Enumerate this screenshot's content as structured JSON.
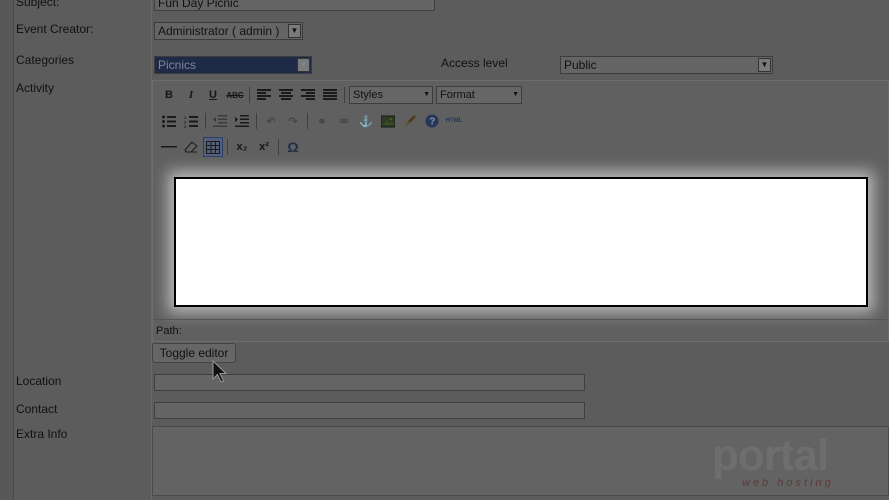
{
  "form": {
    "subject_label": "Subject:",
    "subject_value": "Fun Day Picnic",
    "event_creator_label": "Event Creator:",
    "event_creator_value": "Administrator ( admin )",
    "categories_label": "Categories",
    "categories_value": "Picnics",
    "access_level_label": "Access level",
    "access_level_value": "Public",
    "activity_label": "Activity",
    "location_label": "Location",
    "contact_label": "Contact",
    "extra_info_label": "Extra Info"
  },
  "editor": {
    "bold": "B",
    "italic": "I",
    "underline": "U",
    "strike": "ABC",
    "styles_label": "Styles",
    "format_label": "Format",
    "html_label": "HTML",
    "path_label": "Path:",
    "omega": "Ω",
    "sub_label": "x₂",
    "sup_label": "x²",
    "icons_row1": [
      "bold-icon",
      "italic-icon",
      "underline-icon",
      "strikethrough-icon",
      "align-left-icon",
      "align-center-icon",
      "align-right-icon",
      "align-justify-icon"
    ],
    "icons_row2": [
      "bullet-list-icon",
      "numbered-list-icon",
      "outdent-icon",
      "indent-icon",
      "undo-icon",
      "redo-icon",
      "link-icon",
      "unlink-icon",
      "anchor-icon",
      "image-icon",
      "cleanup-icon",
      "help-icon",
      "html-icon"
    ],
    "icons_row3": [
      "horizontal-rule-icon",
      "remove-format-icon",
      "table-icon",
      "subscript-icon",
      "superscript-icon",
      "special-char-icon"
    ]
  },
  "toggle_editor_label": "Toggle editor",
  "watermark": {
    "text": "portal",
    "subtext": "web hosting"
  }
}
